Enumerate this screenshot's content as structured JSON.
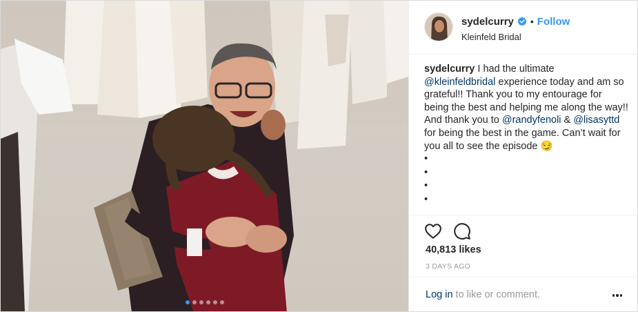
{
  "post": {
    "username": "sydelcurry",
    "follow_label": "Follow",
    "separator": "•",
    "location": "Kleinfeld Bridal",
    "caption": {
      "user": "sydelcurry",
      "t1": " I had the ultimate ",
      "m1": "@kleinfeldbridal",
      "t2": " experience today and am so grateful!! Thank you to my entourage for being the best and helping me along the way!! And thank you to ",
      "m2": "@randyfenoli",
      "t3": " & ",
      "m3": "@lisasyttd",
      "t4": " for being the best in the game. Can’t wait for you all to see the episode 😏",
      "bullets": [
        "•",
        "•",
        "•",
        "•"
      ]
    },
    "likes": "40,813 likes",
    "timestamp": "3 DAYS AGO",
    "comment": {
      "login": "Log in",
      "rest": " to like or comment."
    }
  },
  "carousel": {
    "dots": 6,
    "active_index": 0
  },
  "colors": {
    "accent": "#3897f0",
    "mention": "#003569",
    "muted": "#999999"
  },
  "icons": [
    "verified-icon",
    "heart-icon",
    "comment-icon",
    "more-options-icon"
  ]
}
